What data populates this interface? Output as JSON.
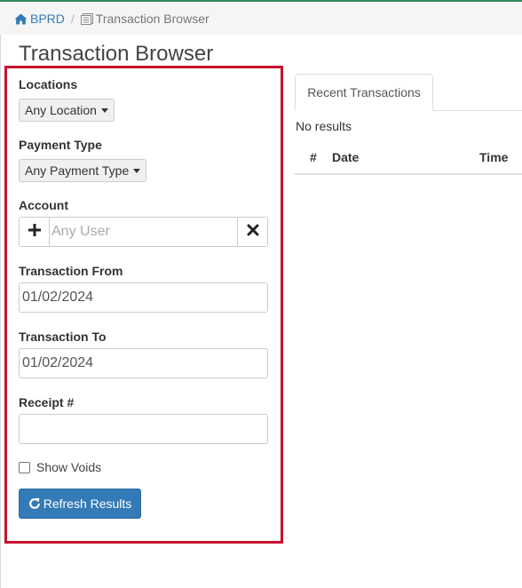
{
  "breadcrumb": {
    "home_label": "BPRD",
    "separator": "/",
    "current_label": "Transaction Browser"
  },
  "page": {
    "title": "Transaction Browser"
  },
  "filters": {
    "locations": {
      "label": "Locations",
      "selected": "Any Location"
    },
    "payment_type": {
      "label": "Payment Type",
      "selected": "Any Payment Type"
    },
    "account": {
      "label": "Account",
      "placeholder": "Any User",
      "value": ""
    },
    "transaction_from": {
      "label": "Transaction From",
      "value": "01/02/2024"
    },
    "transaction_to": {
      "label": "Transaction To",
      "value": "01/02/2024"
    },
    "receipt": {
      "label": "Receipt #",
      "value": ""
    },
    "show_voids": {
      "label": "Show Voids",
      "checked": false
    },
    "refresh_label": "Refresh Results"
  },
  "results": {
    "tab_label": "Recent Transactions",
    "empty_message": "No results",
    "columns": [
      "#",
      "Date",
      "Time"
    ]
  },
  "colors": {
    "accent": "#337ab7",
    "highlight_border": "#c8102e",
    "top_bar": "#2e8b57"
  },
  "icons": {
    "home": "home-icon",
    "list": "list-icon",
    "add": "plus-icon",
    "clear": "close-icon",
    "refresh": "refresh-icon"
  }
}
